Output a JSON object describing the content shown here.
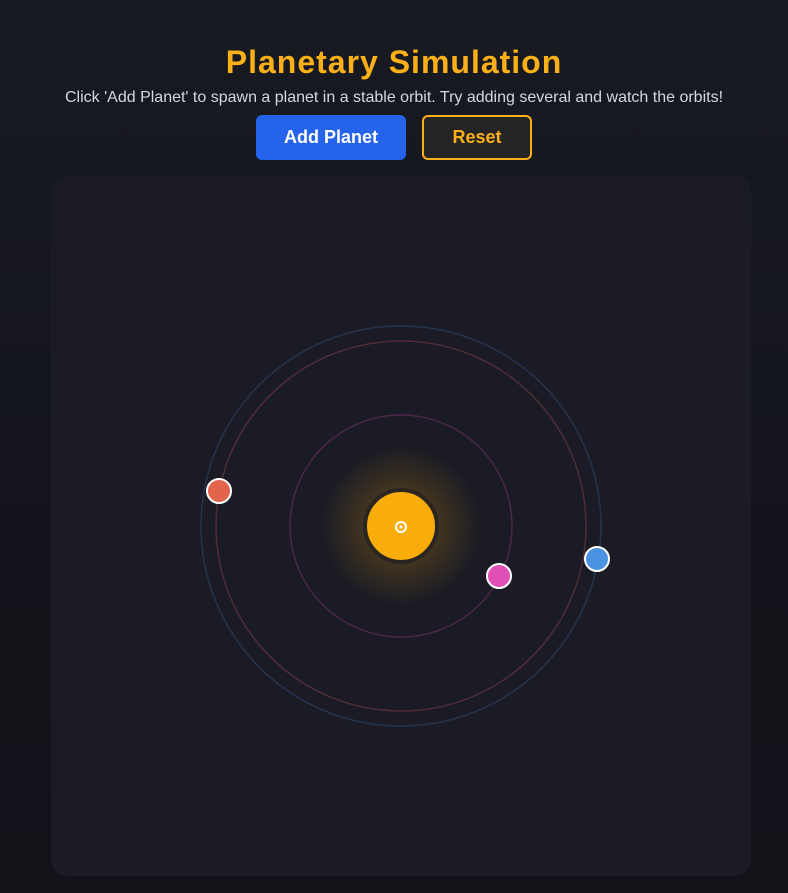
{
  "header": {
    "title": "Planetary Simulation",
    "subtitle": "Click 'Add Planet' to spawn a planet in a stable orbit. Try adding several and watch the orbits!"
  },
  "controls": {
    "add_label": "Add Planet",
    "reset_label": "Reset"
  },
  "simulation": {
    "sun": {
      "color": "#f9ad0a",
      "glyph": "☉"
    },
    "planets": [
      {
        "name": "planet-pink",
        "color": "#e04fb5",
        "orbit_color": "#5a2c5c"
      },
      {
        "name": "planet-red",
        "color": "#e2644c",
        "orbit_color": "#4f2d36"
      },
      {
        "name": "planet-blue",
        "color": "#4b93e0",
        "orbit_color": "#25344d"
      }
    ]
  },
  "colors": {
    "accent": "#fbb017",
    "primary_button": "#2563eb",
    "canvas_bg": "#1a1b24",
    "page_bg": "#14151c"
  }
}
